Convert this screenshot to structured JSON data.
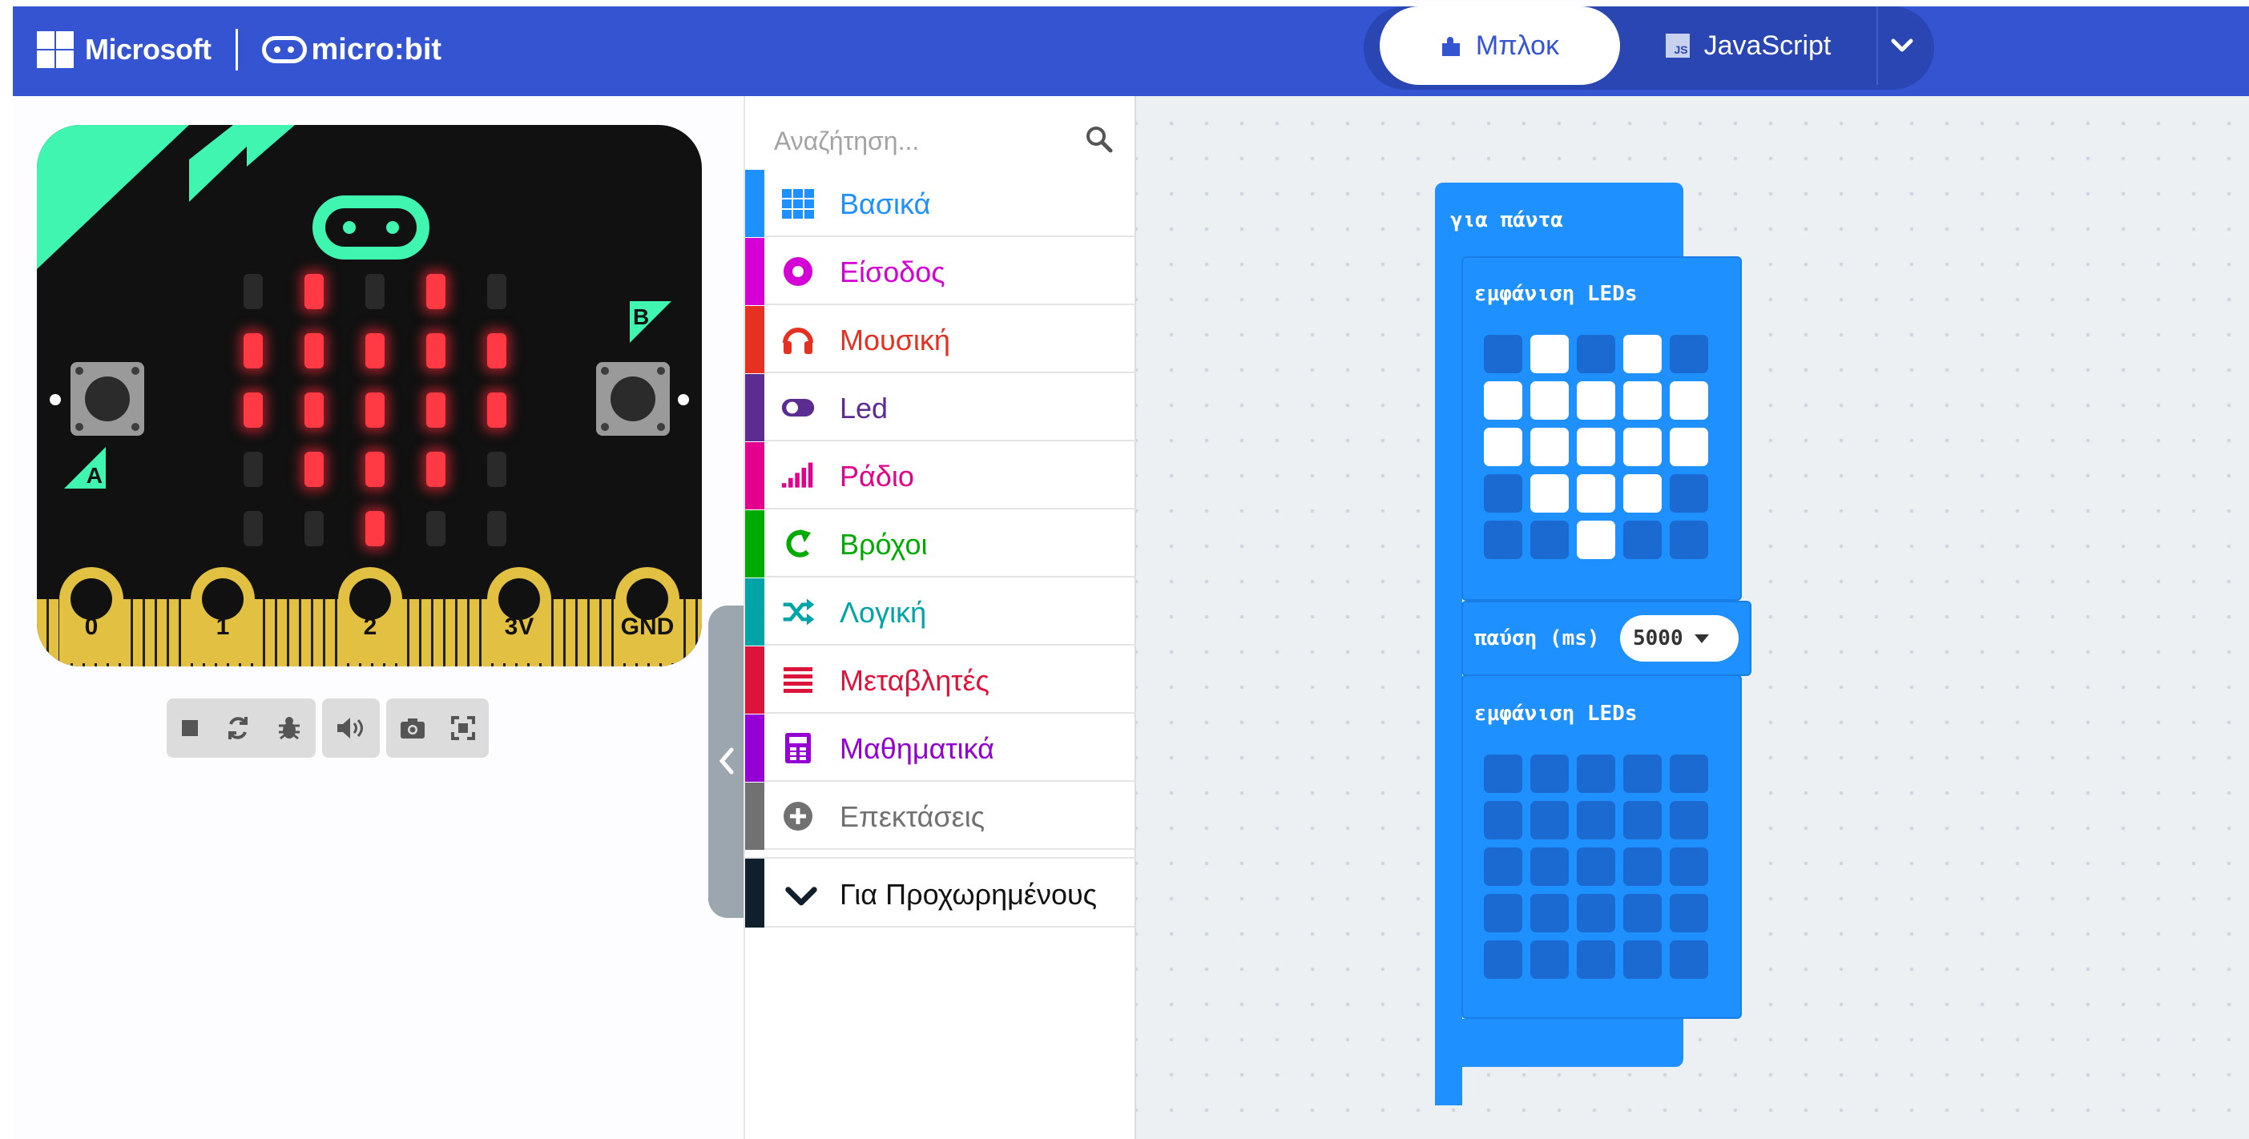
{
  "header": {
    "brand_microsoft": "Microsoft",
    "brand_microbit": "micro:bit",
    "tab_blocks": "Μπλοκ",
    "tab_javascript": "JavaScript",
    "js_badge": "JS",
    "colors": {
      "bar": "#3454d1",
      "toggle": "#2a46b3"
    }
  },
  "simulator": {
    "led_matrix": [
      [
        0,
        1,
        0,
        1,
        0
      ],
      [
        1,
        1,
        1,
        1,
        1
      ],
      [
        1,
        1,
        1,
        1,
        1
      ],
      [
        0,
        1,
        1,
        1,
        0
      ],
      [
        0,
        0,
        1,
        0,
        0
      ]
    ],
    "button_a": "A",
    "button_b": "B",
    "pins": [
      "0",
      "1",
      "2",
      "3V",
      "GND"
    ],
    "tools": [
      "stop-icon",
      "restart-icon",
      "debug-icon",
      "mute-icon",
      "screenshot-icon",
      "fullscreen-icon"
    ],
    "led_on_color": "#ff3a45",
    "accent": "#3ff5b0"
  },
  "toolbox": {
    "search_placeholder": "Αναζήτηση...",
    "categories": [
      {
        "label": "Βασικά",
        "color": "#1e90ff",
        "icon": "grid-icon"
      },
      {
        "label": "Είσοδος",
        "color": "#d400d4",
        "icon": "circle-dot-icon"
      },
      {
        "label": "Μουσική",
        "color": "#e63022",
        "icon": "headphones-icon"
      },
      {
        "label": "Led",
        "color": "#5c2d91",
        "icon": "toggle-icon"
      },
      {
        "label": "Ράδιο",
        "color": "#e3008c",
        "icon": "signal-bars-icon"
      },
      {
        "label": "Βρόχοι",
        "color": "#00aa00",
        "icon": "loop-arrow-icon"
      },
      {
        "label": "Λογική",
        "color": "#00a4a6",
        "icon": "shuffle-icon"
      },
      {
        "label": "Μεταβλητές",
        "color": "#dc143c",
        "icon": "lines-icon"
      },
      {
        "label": "Μαθηματικά",
        "color": "#9400d3",
        "icon": "calculator-icon"
      },
      {
        "label": "Επεκτάσεις",
        "color": "#717171",
        "icon": "plus-circle-icon"
      }
    ],
    "advanced_label": "Για Προχωρημένους",
    "advanced_color": "#0f1f2b"
  },
  "workspace": {
    "forever_label": "για πάντα",
    "show_leds_label": "εμφάνιση LEDs",
    "pause_label": "παύση (ms)",
    "pause_value": "5000",
    "show_leds_1": [
      [
        0,
        1,
        0,
        1,
        0
      ],
      [
        1,
        1,
        1,
        1,
        1
      ],
      [
        1,
        1,
        1,
        1,
        1
      ],
      [
        0,
        1,
        1,
        1,
        0
      ],
      [
        0,
        0,
        1,
        0,
        0
      ]
    ],
    "show_leds_2": [
      [
        0,
        0,
        0,
        0,
        0
      ],
      [
        0,
        0,
        0,
        0,
        0
      ],
      [
        0,
        0,
        0,
        0,
        0
      ],
      [
        0,
        0,
        0,
        0,
        0
      ],
      [
        0,
        0,
        0,
        0,
        0
      ]
    ],
    "block_color": "#1e90ff"
  }
}
